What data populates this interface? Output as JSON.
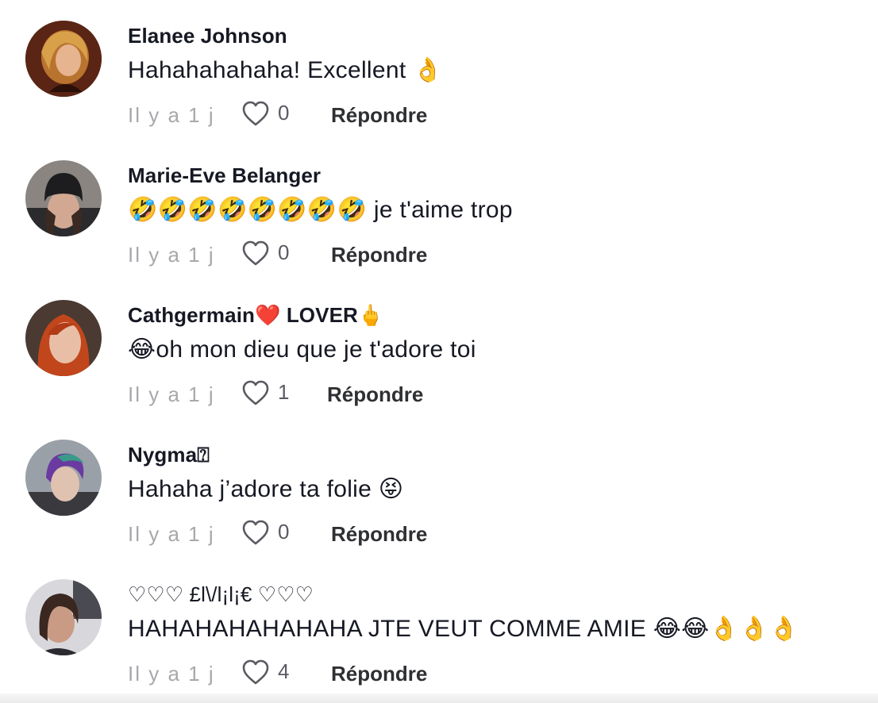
{
  "comments": [
    {
      "username": "Elanee Johnson",
      "text": "Hahahahahaha! Excellent 👌",
      "time": "Il y a 1 j",
      "likes": "0",
      "reply": "Répondre"
    },
    {
      "username": "Marie-Eve Belanger",
      "text": "🤣🤣🤣🤣🤣🤣🤣🤣 je t'aime trop",
      "time": "Il y a 1 j",
      "likes": "0",
      "reply": "Répondre"
    },
    {
      "username": "Cathgermain❤️ LOVER🖕",
      "text": "😂oh mon dieu que je t'adore toi",
      "time": "Il y a 1 j",
      "likes": "1",
      "reply": "Répondre"
    },
    {
      "username": "Nygma⍰",
      "text": "Hahaha j’adore ta folie 😝",
      "time": "Il y a 1 j",
      "likes": "0",
      "reply": "Répondre"
    },
    {
      "username": "♡♡♡ £l\\/l¡l¡€ ♡♡♡",
      "text": "HAHAHAHAHAHAHA JTE VEUT COMME AMIE 😂😂👌👌👌",
      "time": "Il y a 1 j",
      "likes": "4",
      "reply": "Répondre"
    }
  ],
  "icons": {
    "like": "heart-outline-icon"
  },
  "colors": {
    "text": "#161823",
    "secondary": "#a8a8ad",
    "reply": "#2f3033"
  }
}
